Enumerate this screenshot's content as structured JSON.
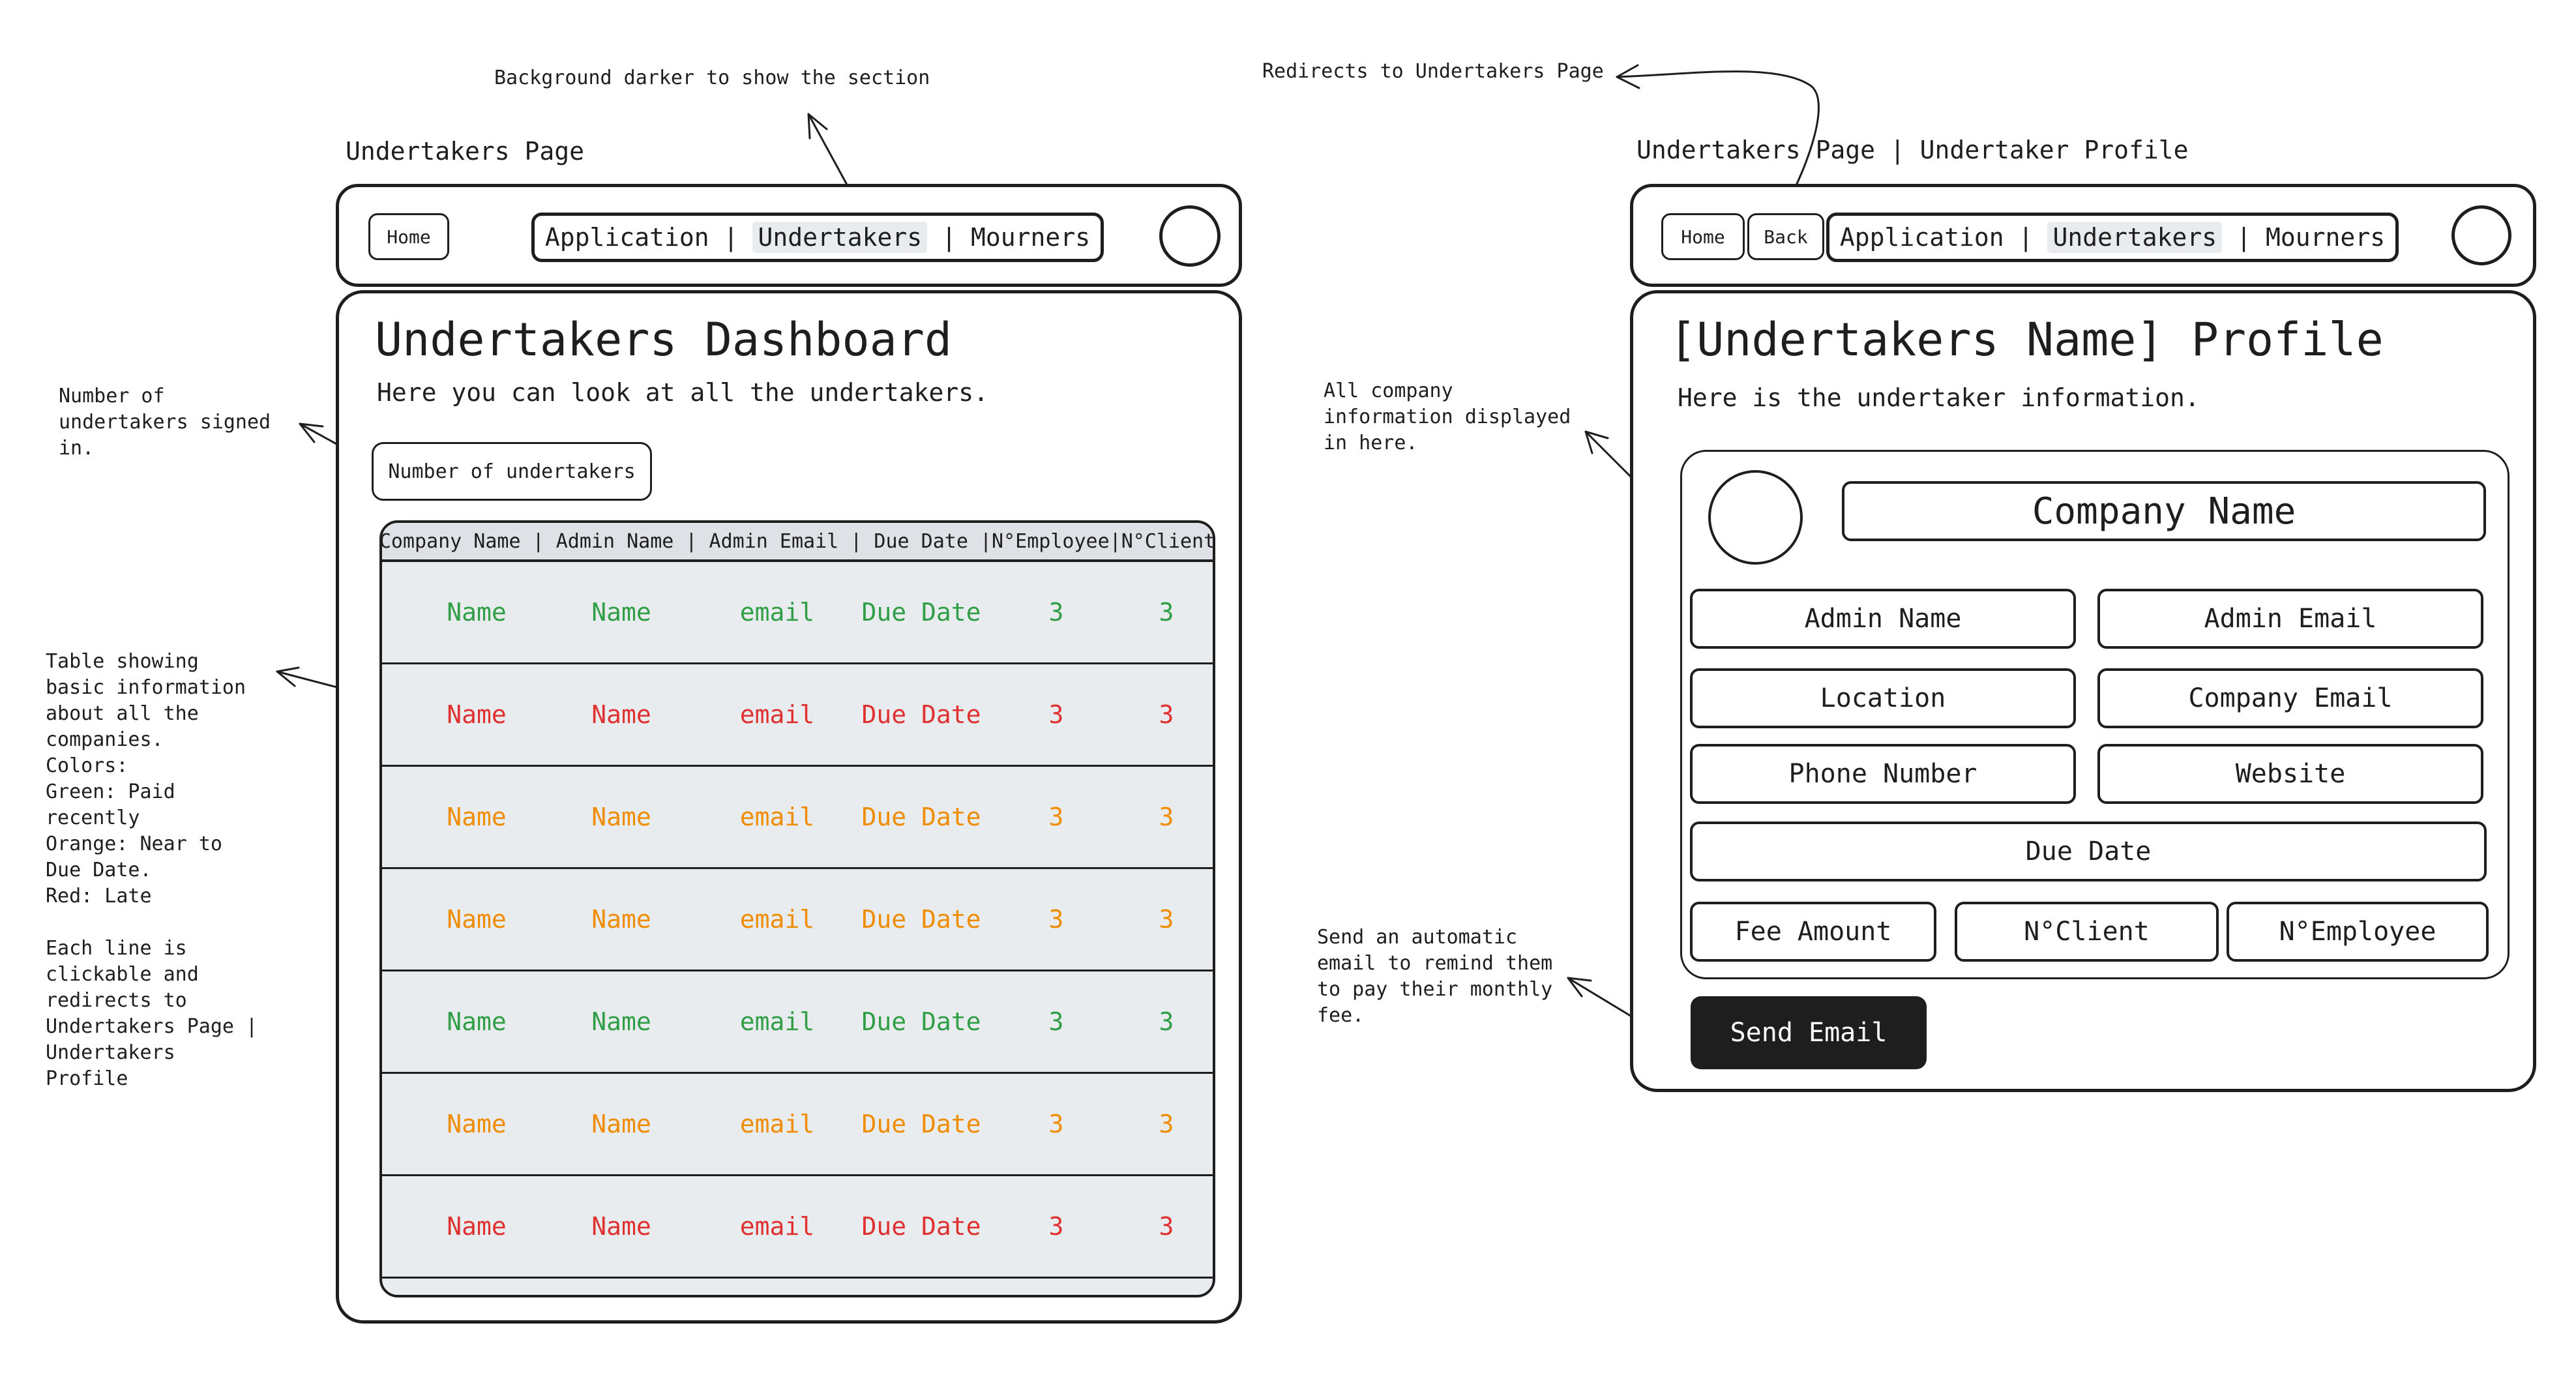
{
  "colors": {
    "stroke": "#1e1e1e",
    "table_bg": "#e9ecef",
    "active_tab_bg": "#e9ecef",
    "green": "#2f9e44",
    "red": "#e03131",
    "orange": "#f08c00",
    "send_button_bg": "#1e1e1e",
    "send_button_text": "#ffffff"
  },
  "annotations": {
    "background_darker": "Background darker to show the section",
    "redirects": "Redirects to Undertakers Page",
    "number_signed": "Number of\nundertakers signed\nin.",
    "table_info": "Table showing\nbasic information\nabout all the\ncompanies.\nColors:\nGreen: Paid\nrecently\nOrange: Near to\nDue Date.\nRed: Late\n\nEach line is\nclickable and\nredirects to\nUndertakers Page |\nUndertakers\nProfile",
    "all_company": "All company\ninformation displayed\nin here.",
    "send_auto": "Send an automatic\nemail to remind them\nto pay their monthly\nfee."
  },
  "nav": {
    "home": "Home",
    "back": "Back",
    "application": "Application",
    "undertakers": "Undertakers",
    "mourners": "Mourners",
    "separator": "|",
    "active_tab": "Undertakers"
  },
  "dashboard": {
    "page_label": "Undertakers Page",
    "title": "Undertakers Dashboard",
    "subtitle": "Here you can look at all the undertakers.",
    "metric_label": "Number of undertakers",
    "table_header": "Company Name | Admin Name | Admin Email | Due Date |N°Employee|N°Client",
    "rows": [
      {
        "status": "green",
        "company": "Name",
        "admin": "Name",
        "email": "email",
        "due": "Due Date",
        "employees": "3",
        "clients": "3"
      },
      {
        "status": "red",
        "company": "Name",
        "admin": "Name",
        "email": "email",
        "due": "Due Date",
        "employees": "3",
        "clients": "3"
      },
      {
        "status": "orange",
        "company": "Name",
        "admin": "Name",
        "email": "email",
        "due": "Due Date",
        "employees": "3",
        "clients": "3"
      },
      {
        "status": "orange",
        "company": "Name",
        "admin": "Name",
        "email": "email",
        "due": "Due Date",
        "employees": "3",
        "clients": "3"
      },
      {
        "status": "green",
        "company": "Name",
        "admin": "Name",
        "email": "email",
        "due": "Due Date",
        "employees": "3",
        "clients": "3"
      },
      {
        "status": "orange",
        "company": "Name",
        "admin": "Name",
        "email": "email",
        "due": "Due Date",
        "employees": "3",
        "clients": "3"
      },
      {
        "status": "red",
        "company": "Name",
        "admin": "Name",
        "email": "email",
        "due": "Due Date",
        "employees": "3",
        "clients": "3"
      }
    ]
  },
  "profile": {
    "page_label": "Undertakers Page | Undertaker Profile",
    "title": "[Undertakers Name] Profile",
    "subtitle": "Here is the undertaker information.",
    "company_name": "Company Name",
    "admin_name": "Admin Name",
    "admin_email": "Admin Email",
    "location": "Location",
    "company_email": "Company Email",
    "phone": "Phone Number",
    "website": "Website",
    "due_date": "Due Date",
    "fee_amount": "Fee Amount",
    "n_client": "N°Client",
    "n_employee": "N°Employee",
    "send_button": "Send Email"
  }
}
